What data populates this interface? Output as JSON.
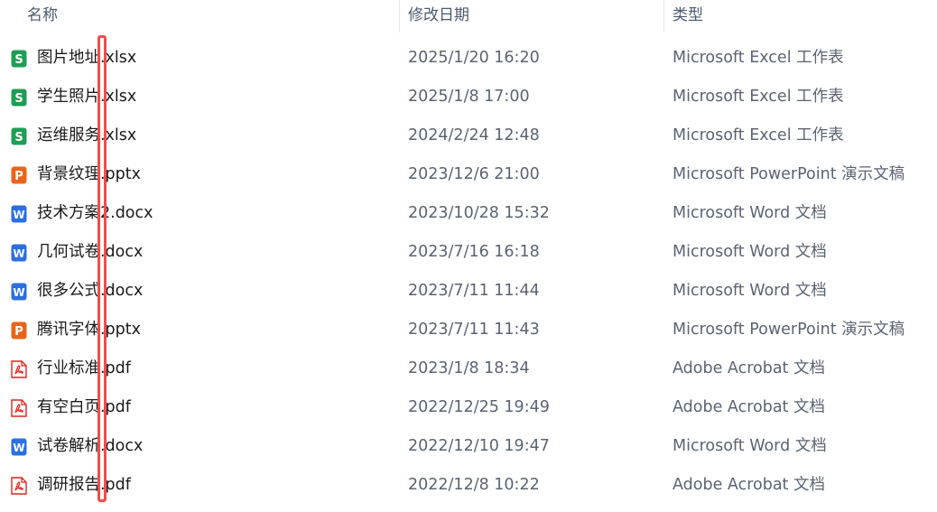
{
  "columns": {
    "name": "名称",
    "date": "修改日期",
    "type": "类型"
  },
  "colors": {
    "excel": "#1f9d55",
    "powerpoint": "#e8651a",
    "word": "#2b6fe0",
    "pdf": "#e2231a",
    "highlight": "#f04e4e"
  },
  "files": [
    {
      "name": "图片地址.xlsx",
      "date": "2025/1/20 16:20",
      "type": "Microsoft Excel 工作表",
      "icon": "excel-icon"
    },
    {
      "name": "学生照片.xlsx",
      "date": "2025/1/8 17:00",
      "type": "Microsoft Excel 工作表",
      "icon": "excel-icon"
    },
    {
      "name": "运维服务.xlsx",
      "date": "2024/2/24 12:48",
      "type": "Microsoft Excel 工作表",
      "icon": "excel-icon"
    },
    {
      "name": "背景纹理.pptx",
      "date": "2023/12/6 21:00",
      "type": "Microsoft PowerPoint 演示文稿",
      "icon": "powerpoint-icon"
    },
    {
      "name": "技术方案2.docx",
      "date": "2023/10/28 15:32",
      "type": "Microsoft Word 文档",
      "icon": "word-icon"
    },
    {
      "name": "几何试卷.docx",
      "date": "2023/7/16 16:18",
      "type": "Microsoft Word 文档",
      "icon": "word-icon"
    },
    {
      "name": "很多公式.docx",
      "date": "2023/7/11 11:44",
      "type": "Microsoft Word 文档",
      "icon": "word-icon"
    },
    {
      "name": "腾讯字体.pptx",
      "date": "2023/7/11 11:43",
      "type": "Microsoft PowerPoint 演示文稿",
      "icon": "powerpoint-icon"
    },
    {
      "name": "行业标准.pdf",
      "date": "2023/1/8 18:34",
      "type": "Adobe Acrobat 文档",
      "icon": "pdf-icon"
    },
    {
      "name": "有空白页.pdf",
      "date": "2022/12/25 19:49",
      "type": "Adobe Acrobat 文档",
      "icon": "pdf-icon"
    },
    {
      "name": "试卷解析.docx",
      "date": "2022/12/10 19:47",
      "type": "Microsoft Word 文档",
      "icon": "word-icon"
    },
    {
      "name": "调研报告.pdf",
      "date": "2022/12/8 10:22",
      "type": "Adobe Acrobat 文档",
      "icon": "pdf-icon"
    }
  ]
}
